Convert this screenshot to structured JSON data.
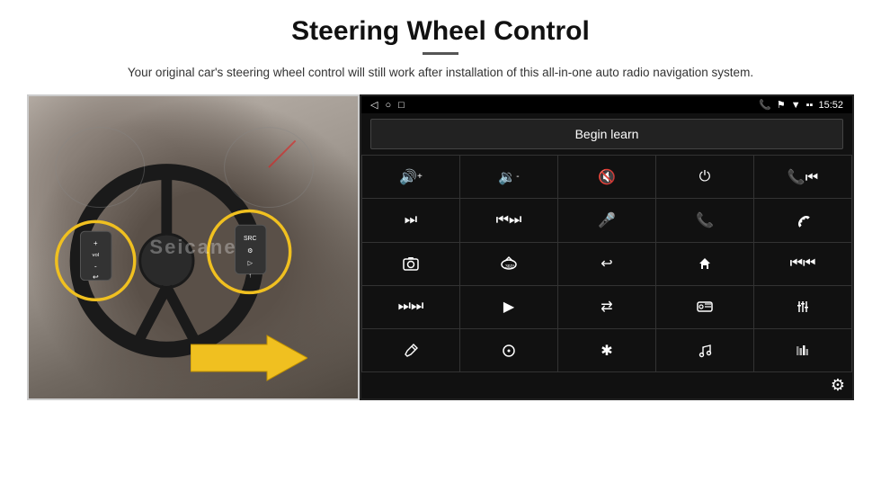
{
  "header": {
    "title": "Steering Wheel Control",
    "subtitle": "Your original car's steering wheel control will still work after installation of this all-in-one auto radio navigation system."
  },
  "status_bar": {
    "time": "15:52",
    "left_icons": [
      "◁",
      "○",
      "□"
    ],
    "right_icons": [
      "📞",
      "📍",
      "📶",
      "🔋"
    ]
  },
  "begin_learn_btn": "Begin learn",
  "controls": [
    {
      "icon": "🔊+",
      "label": "vol-up"
    },
    {
      "icon": "🔊-",
      "label": "vol-down"
    },
    {
      "icon": "🔇",
      "label": "mute"
    },
    {
      "icon": "⏻",
      "label": "power"
    },
    {
      "icon": "📞⏮",
      "label": "phone-prev"
    },
    {
      "icon": "⏭",
      "label": "next"
    },
    {
      "icon": "⏮⏭",
      "label": "seek"
    },
    {
      "icon": "🎤",
      "label": "mic"
    },
    {
      "icon": "📞",
      "label": "call"
    },
    {
      "icon": "📞↩",
      "label": "hang-up"
    },
    {
      "icon": "📷",
      "label": "camera"
    },
    {
      "icon": "360°",
      "label": "360"
    },
    {
      "icon": "↩",
      "label": "back"
    },
    {
      "icon": "🏠",
      "label": "home"
    },
    {
      "icon": "⏮⏮",
      "label": "prev-track"
    },
    {
      "icon": "⏭⏭",
      "label": "fast-forward"
    },
    {
      "icon": "▶",
      "label": "navigate"
    },
    {
      "icon": "⇄",
      "label": "switch"
    },
    {
      "icon": "📻",
      "label": "radio"
    },
    {
      "icon": "⚙",
      "label": "eq"
    },
    {
      "icon": "✏",
      "label": "edit"
    },
    {
      "icon": "⊙",
      "label": "circle"
    },
    {
      "icon": "✱",
      "label": "bluetooth"
    },
    {
      "icon": "♫",
      "label": "music"
    },
    {
      "icon": "📊",
      "label": "equalizer"
    }
  ],
  "watermark": "Seicane",
  "gear_icon": "⚙"
}
